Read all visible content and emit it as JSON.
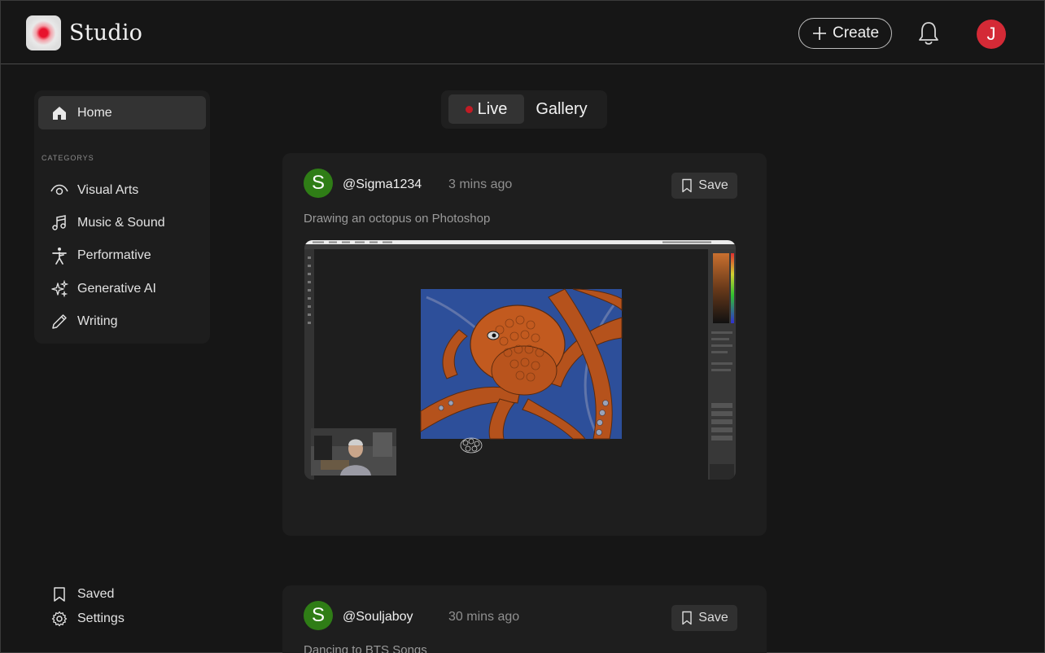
{
  "header": {
    "brand": "Studio",
    "create_label": "Create",
    "avatar_initial": "J"
  },
  "sidebar": {
    "home_label": "Home",
    "categories_heading": "CATEGORYS",
    "categories": [
      {
        "label": "Visual Arts",
        "icon": "eye-icon"
      },
      {
        "label": "Music & Sound",
        "icon": "music-note-icon"
      },
      {
        "label": "Performative",
        "icon": "dancer-icon"
      },
      {
        "label": "Generative AI",
        "icon": "sparkles-icon"
      },
      {
        "label": "Writing",
        "icon": "pencil-icon"
      }
    ],
    "saved_label": "Saved",
    "settings_label": "Settings"
  },
  "toggle": {
    "live_label": "Live",
    "gallery_label": "Gallery",
    "active": "Live"
  },
  "feed": [
    {
      "avatar_initial": "S",
      "username": "@Sigma1234",
      "time": "3 mins ago",
      "save_label": "Save",
      "description": "Drawing an octopus on Photoshop"
    },
    {
      "avatar_initial": "S",
      "username": "@Souljaboy",
      "time": "30 mins ago",
      "save_label": "Save",
      "description": "Dancing to BTS Songs"
    }
  ],
  "colors": {
    "background": "#161616",
    "panel": "#1e1e1e",
    "accent_red": "#d42a36",
    "live_dot": "#c21b24",
    "avatar_green": "#2f7d16"
  }
}
